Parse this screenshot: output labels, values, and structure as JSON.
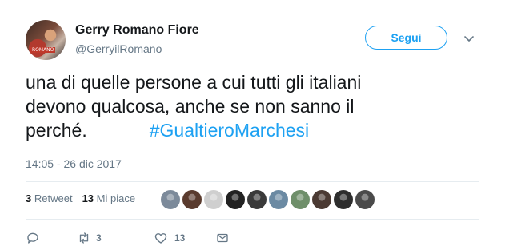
{
  "author": {
    "name": "Gerry Romano Fiore",
    "handle": "@GerryilRomano",
    "avatar_icon": "profile-photo"
  },
  "follow_button": {
    "label": "Segui"
  },
  "tweet": {
    "lines": [
      "una di quelle persone a cui tutti gli italiani",
      "devono qualcosa, anche se non sanno il",
      "perché."
    ],
    "hashtag": "#GualtieroMarchesi",
    "timestamp": "14:05 - 26 dic 2017"
  },
  "stats": {
    "retweet_count": "3",
    "retweet_label": "Retweet",
    "like_count": "13",
    "like_label": "Mi piace"
  },
  "likers": [
    {
      "color": "#7c8a9a"
    },
    {
      "color": "#5a3b2e"
    },
    {
      "color": "#cfcfcf"
    },
    {
      "color": "#222222"
    },
    {
      "color": "#3a3a3a"
    },
    {
      "color": "#6b8aa3"
    },
    {
      "color": "#6f8f6a"
    },
    {
      "color": "#4b3a33"
    },
    {
      "color": "#2e2e2e"
    },
    {
      "color": "#4a4a4a"
    }
  ],
  "actions": {
    "reply_icon": "reply-icon",
    "retweet_icon": "retweet-icon",
    "retweet_count": "3",
    "like_icon": "heart-icon",
    "like_count": "13",
    "message_icon": "envelope-icon"
  },
  "colors": {
    "accent": "#1da1f2",
    "muted": "#657786",
    "text": "#14171a"
  }
}
